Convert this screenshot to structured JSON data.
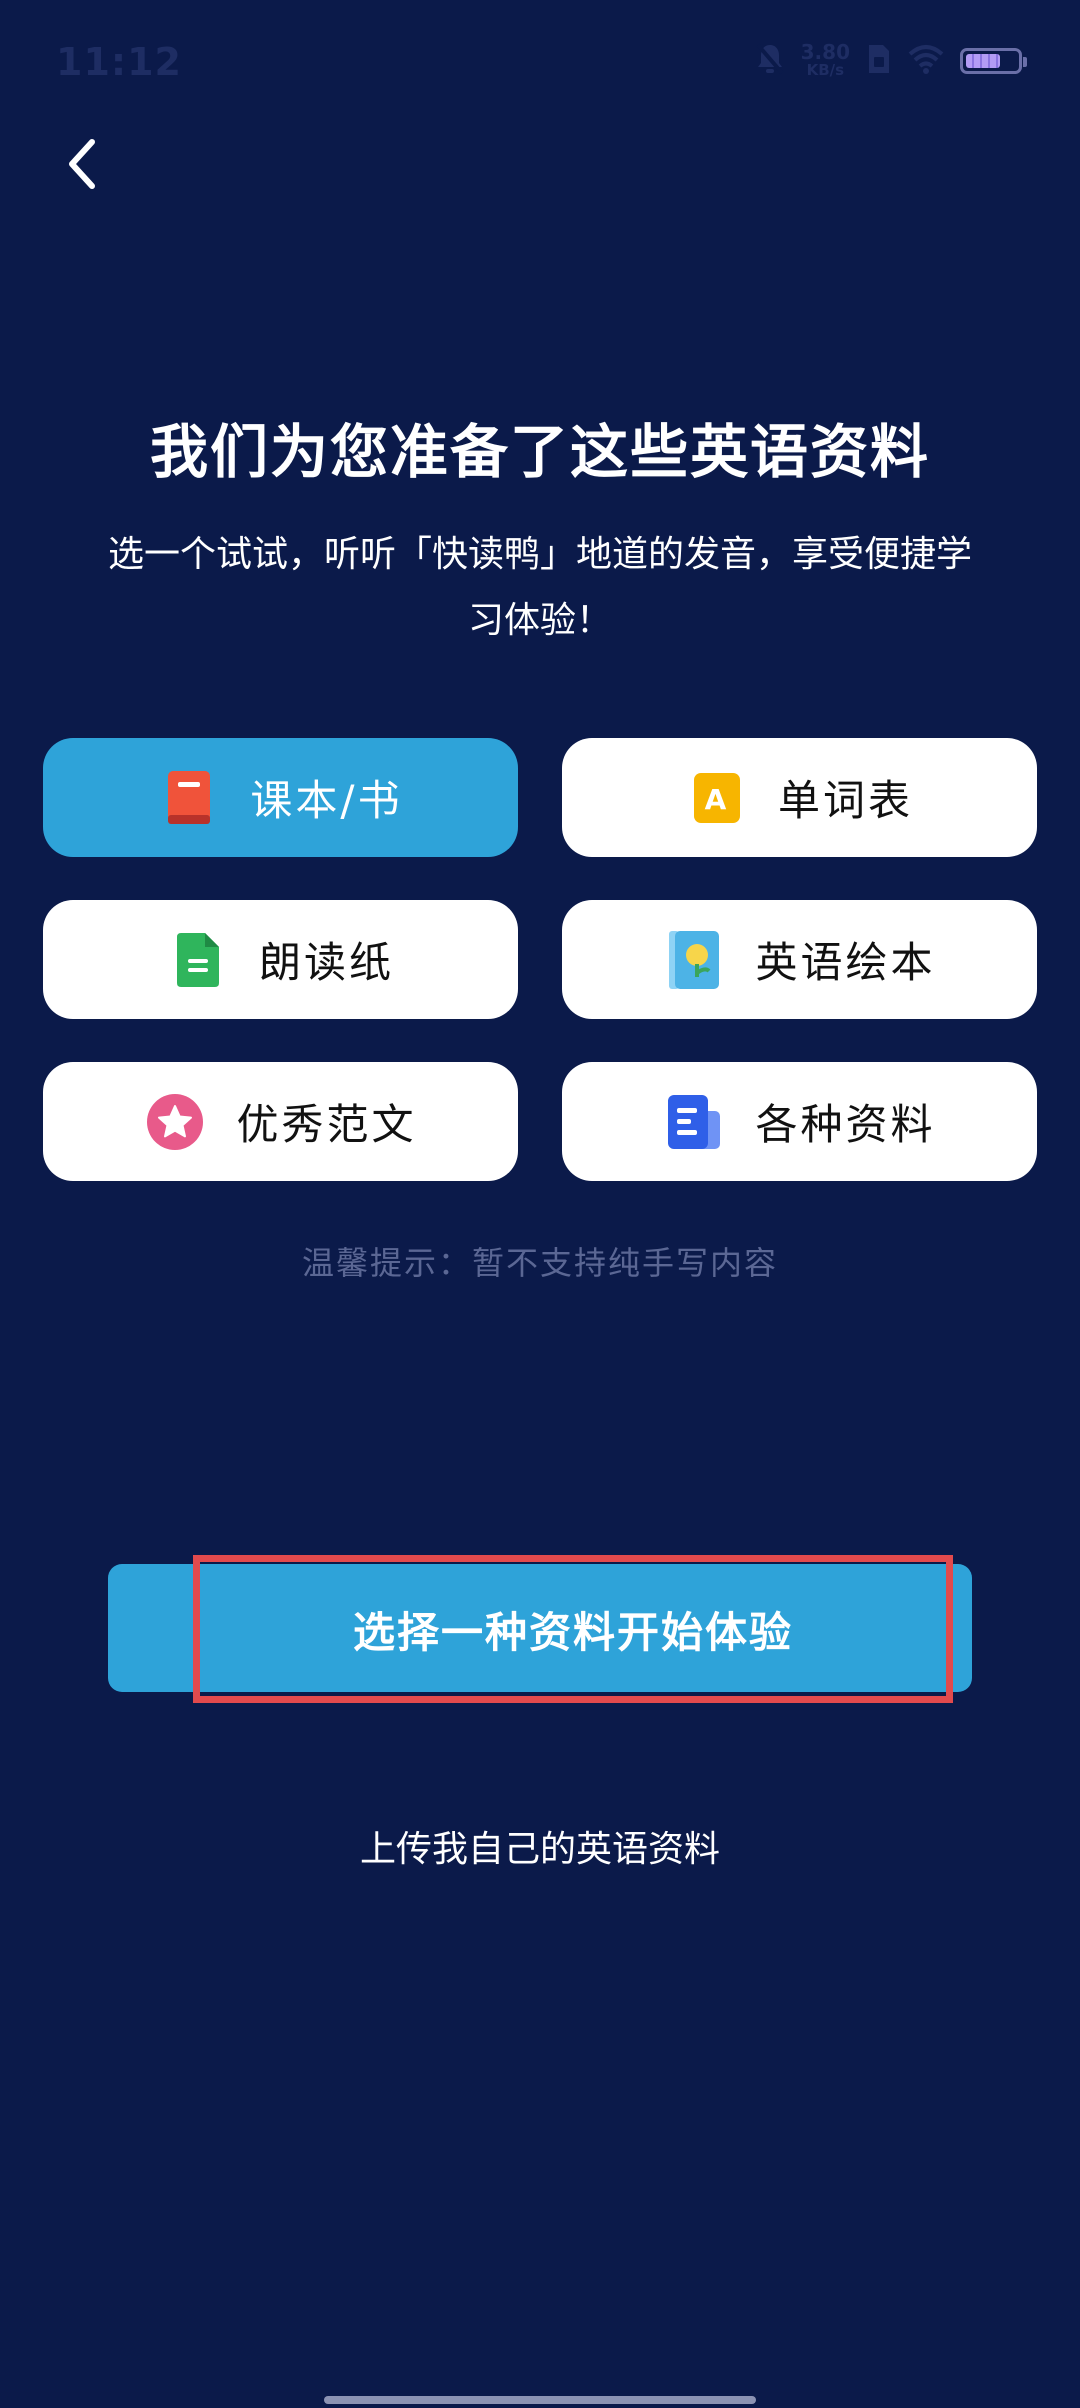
{
  "status_bar": {
    "time": "11:12",
    "net_speed_value": "3.80",
    "net_speed_unit": "KB/s"
  },
  "header": {
    "title": "我们为您准备了这些英语资料",
    "subtitle": "选一个试试，听听「快读鸭」地道的发音，享受便捷学习体验！"
  },
  "options": [
    {
      "label": "课本/书",
      "icon": "book-icon",
      "color": "#f0533a",
      "selected": true
    },
    {
      "label": "单词表",
      "icon": "letter-a-icon",
      "color": "#f7b500",
      "selected": false
    },
    {
      "label": "朗读纸",
      "icon": "document-icon",
      "color": "#2fb55c",
      "selected": false
    },
    {
      "label": "英语绘本",
      "icon": "picture-book-icon",
      "color": "#4db3e6",
      "selected": false
    },
    {
      "label": "优秀范文",
      "icon": "star-icon",
      "color": "#e85a8a",
      "selected": false
    },
    {
      "label": "各种资料",
      "icon": "files-icon",
      "color": "#2f5fe8",
      "selected": false
    }
  ],
  "tip": "温馨提示：暂不支持纯手写内容",
  "primary_button": "选择一种资料开始体验",
  "upload_link": "上传我自己的英语资料",
  "colors": {
    "background": "#0b1a4a",
    "accent": "#2ea3d9",
    "highlight": "#e24a4d"
  }
}
